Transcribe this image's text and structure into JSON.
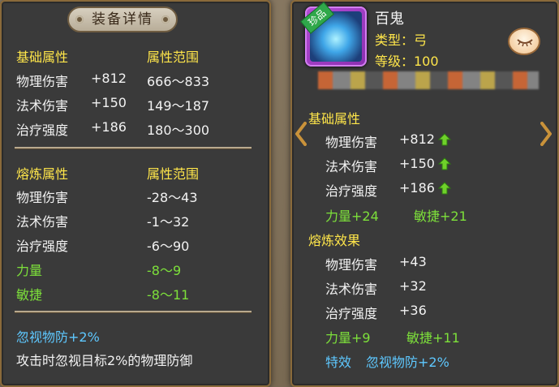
{
  "left_panel": {
    "title": "装备详情",
    "basic_header": "基础属性",
    "basic_range_header": "属性范围",
    "basic_stats": [
      {
        "name": "物理伤害",
        "value": "+812",
        "range": "666～833"
      },
      {
        "name": "法术伤害",
        "value": "+150",
        "range": "149～187"
      },
      {
        "name": "治疗强度",
        "value": "+186",
        "range": "180～300"
      }
    ],
    "refine_header": "熔炼属性",
    "refine_range_header": "属性范围",
    "refine_stats": [
      {
        "name": "物理伤害",
        "range": "-28～43",
        "color": "white"
      },
      {
        "name": "法术伤害",
        "range": "-1～32",
        "color": "white"
      },
      {
        "name": "治疗强度",
        "range": "-6～90",
        "color": "white"
      },
      {
        "name": "力量",
        "range": "-8～9",
        "color": "green"
      },
      {
        "name": "敏捷",
        "range": "-8～11",
        "color": "green"
      }
    ],
    "special_title": "忽视物防+2%",
    "special_desc": "攻击时忽视目标2%的物理防御"
  },
  "right_panel": {
    "badge": "珍品",
    "item_name": "百鬼",
    "type_label": "类型：弓",
    "level_label": "等级：100",
    "basic_header": "基础属性",
    "basic_stats": [
      {
        "name": "物理伤害",
        "value": "+812"
      },
      {
        "name": "法术伤害",
        "value": "+150"
      },
      {
        "name": "治疗强度",
        "value": "+186"
      }
    ],
    "basic_extra": {
      "str": "力量+24",
      "agi": "敏捷+21"
    },
    "refine_header": "熔炼效果",
    "refine_stats": [
      {
        "name": "物理伤害",
        "value": "+43"
      },
      {
        "name": "法术伤害",
        "value": "+32"
      },
      {
        "name": "治疗强度",
        "value": "+36"
      }
    ],
    "refine_extra": {
      "str": "力量+9",
      "agi": "敏捷+11"
    },
    "effect_label": "特效",
    "effect_value": "忽视物防+2%"
  },
  "colors": {
    "yellow": "#ffe64a",
    "white": "#f2f2f2",
    "green": "#7de03a",
    "cyan": "#5ec8ff",
    "panel_bg": "#3a3a3a",
    "border": "#8a6a3a"
  },
  "icons": [
    "eye-closed-icon",
    "arrow-left-icon",
    "arrow-right-icon",
    "up-arrow-icon",
    "weapon-icon"
  ]
}
